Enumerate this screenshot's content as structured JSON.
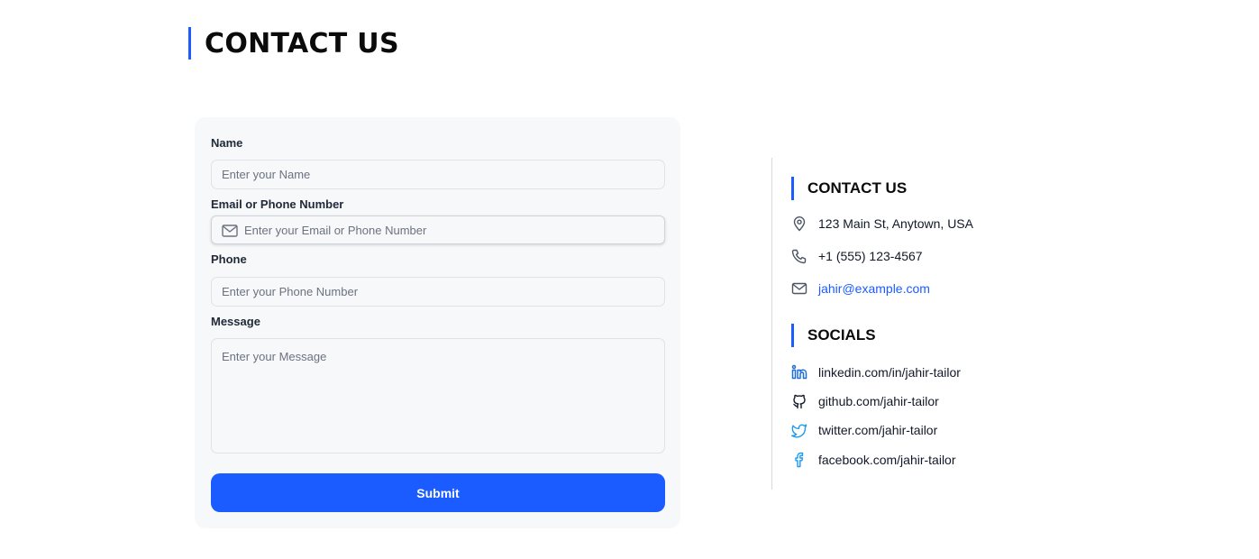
{
  "page": {
    "title": "CONTACT US"
  },
  "form": {
    "name": {
      "label": "Name",
      "placeholder": "Enter your Name",
      "value": ""
    },
    "email": {
      "label": "Email or Phone Number",
      "placeholder": "Enter your Email or Phone Number",
      "value": ""
    },
    "phone": {
      "label": "Phone",
      "placeholder": "Enter your Phone Number",
      "value": ""
    },
    "message": {
      "label": "Message",
      "placeholder": "Enter your Message",
      "value": ""
    },
    "submit_label": "Submit"
  },
  "contact": {
    "heading": "CONTACT US",
    "address": {
      "icon": "map-pin-icon",
      "text": "123 Main St, Anytown, USA"
    },
    "phone": {
      "icon": "phone-icon",
      "text": "+1 (555) 123-4567"
    },
    "email": {
      "icon": "mail-icon",
      "text": "jahir@example.com"
    }
  },
  "socials": {
    "heading": "SOCIALS",
    "items": [
      {
        "icon": "linkedin-icon",
        "text": "linkedin.com/in/jahir-tailor"
      },
      {
        "icon": "github-icon",
        "text": "github.com/jahir-tailor"
      },
      {
        "icon": "twitter-icon",
        "text": "twitter.com/jahir-tailor"
      },
      {
        "icon": "facebook-icon",
        "text": "facebook.com/jahir-tailor"
      }
    ]
  },
  "colors": {
    "accent": "#1a5cff",
    "card_background": "#f7f8fa",
    "link": "#1a5cff",
    "social_icon": "#1d9bf0"
  }
}
